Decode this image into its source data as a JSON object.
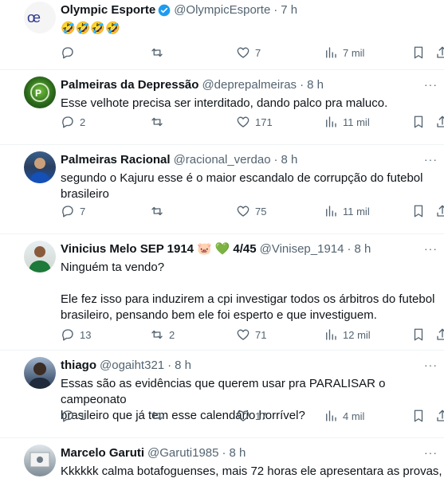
{
  "tweets": [
    {
      "name": "Olympic Esporte",
      "verified": true,
      "handle": "@OlympicEsporte",
      "time": "7 h",
      "text": "🤣🤣🤣🤣",
      "replies": "",
      "retweets": "",
      "likes": "7",
      "views": "7 mil"
    },
    {
      "name": "Palmeiras da Depressão",
      "handle": "@deprepalmeiras",
      "time": "8 h",
      "text": "Esse velhote precisa ser interditado, dando palco pra maluco.",
      "replies": "2",
      "retweets": "",
      "likes": "171",
      "views": "11 mil"
    },
    {
      "name": "Palmeiras Racional",
      "handle": "@racional_verdao",
      "time": "8 h",
      "text": "segundo o Kajuru esse é o maior escandalo de corrupção do futebol\nbrasileiro",
      "replies": "7",
      "retweets": "",
      "likes": "75",
      "views": "11 mil"
    },
    {
      "name": "Vinicius Melo SEP 1914",
      "name_suffix": "4/45",
      "handle": "@Vinisep_1914",
      "time": "8 h",
      "text": "Ninguém ta vendo?\n\nEle fez isso para induzirem a cpi investigar todos os árbitros do futebol\nbrasileiro, pensando bem ele foi esperto e que investiguem.",
      "replies": "13",
      "retweets": "2",
      "likes": "71",
      "views": "12 mil"
    },
    {
      "name": "thiago",
      "handle": "@ogaiht321",
      "time": "8 h",
      "text": "Essas são as evidências que querem usar pra PARALISAR o campeonato\nbrasileiro que já tem esse calendário horrível?",
      "replies": "1",
      "retweets": "",
      "likes": "17",
      "views": "4 mil"
    },
    {
      "name": "Marcelo Garuti",
      "handle": "@Garuti1985",
      "time": "8 h",
      "text": "Kkkkkk calma botafoguenses, mais 72 horas ele apresentara as provas,"
    }
  ],
  "colors": {
    "secondary": "#536471",
    "primary_text": "#0f1419",
    "verified": "#1d9bf0"
  },
  "icons": [
    "reply-icon",
    "retweet-icon",
    "like-icon",
    "views-icon",
    "bookmark-icon",
    "share-icon",
    "more-icon",
    "verified-icon"
  ]
}
